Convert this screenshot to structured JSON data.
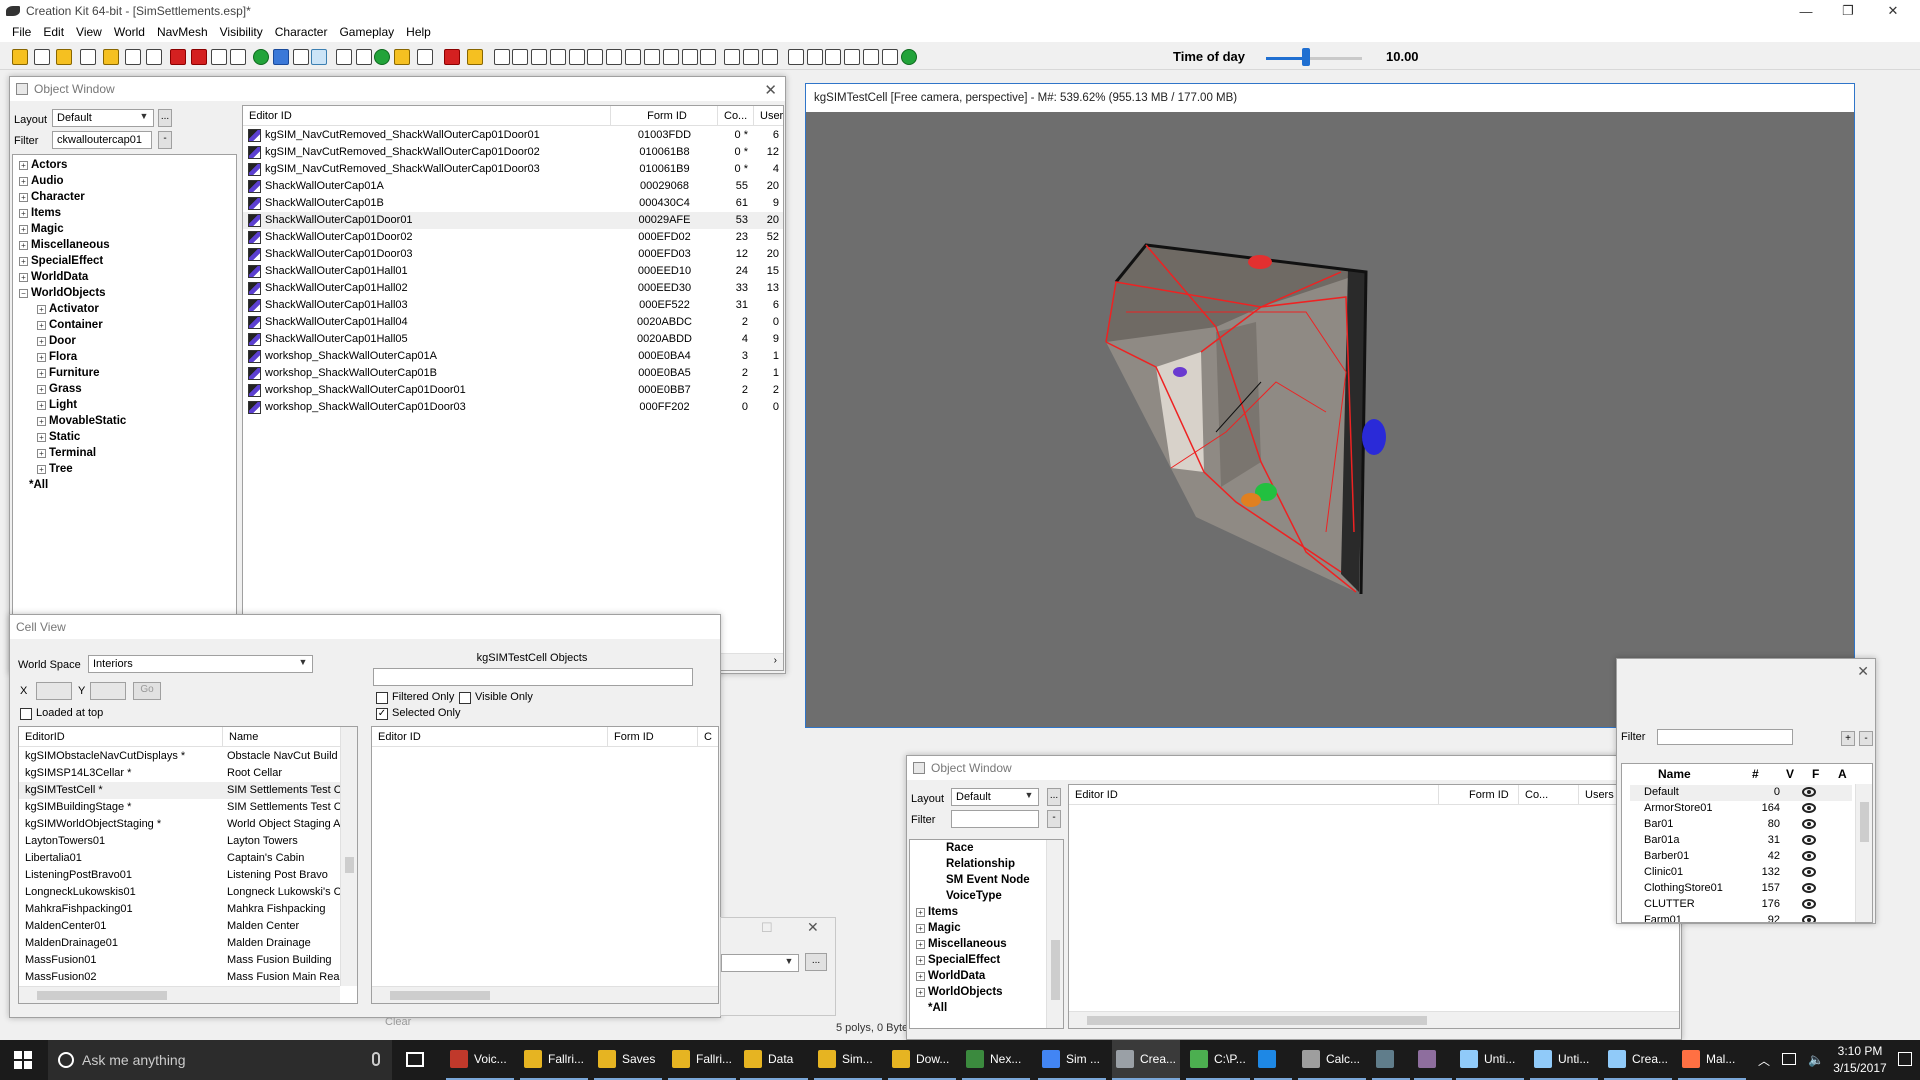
{
  "titlebar": {
    "title": "Creation Kit 64-bit - [SimSettlements.esp]*",
    "minimize": "—",
    "restore": "❐",
    "close": "✕"
  },
  "menubar": {
    "items": [
      "File",
      "Edit",
      "View",
      "World",
      "NavMesh",
      "Visibility",
      "Character",
      "Gameplay",
      "Help"
    ]
  },
  "toolbar": {
    "time_of_day_label": "Time of day",
    "time_of_day_value": "10.00",
    "time_of_day_slider_fraction": 0.42
  },
  "object_window": {
    "title": "Object Window",
    "layout_label": "Layout",
    "layout_value": "Default",
    "layout_more": "...",
    "filter_label": "Filter",
    "filter_value": "ckwalloutercap01",
    "filter_btn": "-",
    "tree": {
      "top": [
        "Actors",
        "Audio",
        "Character",
        "Items",
        "Magic",
        "Miscellaneous",
        "SpecialEffect",
        "WorldData",
        "WorldObjects"
      ],
      "children": [
        "Activator",
        "Container",
        "Door",
        "Flora",
        "Furniture",
        "Grass",
        "Light",
        "MovableStatic",
        "Static",
        "Terminal",
        "Tree"
      ],
      "all": "*All"
    },
    "columns": [
      "Editor ID",
      "Form ID",
      "Co...",
      "User"
    ],
    "rows": [
      {
        "id": "kgSIM_NavCutRemoved_ShackWallOuterCap01Door01",
        "form": "01003FDD",
        "count": "0 *",
        "users": "6"
      },
      {
        "id": "kgSIM_NavCutRemoved_ShackWallOuterCap01Door02",
        "form": "010061B8",
        "count": "0 *",
        "users": "12"
      },
      {
        "id": "kgSIM_NavCutRemoved_ShackWallOuterCap01Door03",
        "form": "010061B9",
        "count": "0 *",
        "users": "4"
      },
      {
        "id": "ShackWallOuterCap01A",
        "form": "00029068",
        "count": "55",
        "users": "20"
      },
      {
        "id": "ShackWallOuterCap01B",
        "form": "000430C4",
        "count": "61",
        "users": "9"
      },
      {
        "id": "ShackWallOuterCap01Door01",
        "form": "00029AFE",
        "count": "53",
        "users": "20"
      },
      {
        "id": "ShackWallOuterCap01Door02",
        "form": "000EFD02",
        "count": "23",
        "users": "52"
      },
      {
        "id": "ShackWallOuterCap01Door03",
        "form": "000EFD03",
        "count": "12",
        "users": "20"
      },
      {
        "id": "ShackWallOuterCap01Hall01",
        "form": "000EED10",
        "count": "24",
        "users": "15"
      },
      {
        "id": "ShackWallOuterCap01Hall02",
        "form": "000EED30",
        "count": "33",
        "users": "13"
      },
      {
        "id": "ShackWallOuterCap01Hall03",
        "form": "000EF522",
        "count": "31",
        "users": "6"
      },
      {
        "id": "ShackWallOuterCap01Hall04",
        "form": "0020ABDC",
        "count": "2",
        "users": "0"
      },
      {
        "id": "ShackWallOuterCap01Hall05",
        "form": "0020ABDD",
        "count": "4",
        "users": "9"
      },
      {
        "id": "workshop_ShackWallOuterCap01A",
        "form": "000E0BA4",
        "count": "3",
        "users": "1"
      },
      {
        "id": "workshop_ShackWallOuterCap01B",
        "form": "000E0BA5",
        "count": "2",
        "users": "1"
      },
      {
        "id": "workshop_ShackWallOuterCap01Door01",
        "form": "000E0BB7",
        "count": "2",
        "users": "2"
      },
      {
        "id": "workshop_ShackWallOuterCap01Door03",
        "form": "000FF202",
        "count": "0",
        "users": "0"
      }
    ]
  },
  "render_window": {
    "title": "kgSIMTestCell [Free camera, perspective] - M#: 539.62% (955.13 MB / 177.00 MB)"
  },
  "cell_view": {
    "title": "Cell View",
    "world_space_label": "World Space",
    "world_space_value": "Interiors",
    "x_label": "X",
    "y_label": "Y",
    "go_label": "Go",
    "loaded_at_top": "Loaded at top",
    "objects_title": "kgSIMTestCell Objects",
    "filtered_only": "Filtered Only",
    "visible_only": "Visible Only",
    "selected_only": "Selected Only",
    "left_columns": [
      "EditorID",
      "Name"
    ],
    "right_columns": [
      "Editor ID",
      "Form ID",
      "C"
    ],
    "cells": [
      {
        "editor": "kgSIMObstacleNavCutDisplays *",
        "name": "Obstacle NavCut Build C"
      },
      {
        "editor": "kgSIMSP14L3Cellar *",
        "name": "Root Cellar"
      },
      {
        "editor": "kgSIMTestCell *",
        "name": "SIM Settlements Test Ce"
      },
      {
        "editor": "kgSIMBuildingStage *",
        "name": "SIM Settlements Test Ce"
      },
      {
        "editor": "kgSIMWorldObjectStaging *",
        "name": "World Object Staging Ar"
      },
      {
        "editor": "LaytonTowers01",
        "name": "Layton Towers"
      },
      {
        "editor": "Libertalia01",
        "name": "Captain's Cabin"
      },
      {
        "editor": "ListeningPostBravo01",
        "name": "Listening Post Bravo"
      },
      {
        "editor": "LongneckLukowskis01",
        "name": "Longneck Lukowski's Ca"
      },
      {
        "editor": "MahkraFishpacking01",
        "name": "Mahkra Fishpacking"
      },
      {
        "editor": "MaldenCenter01",
        "name": "Malden Center"
      },
      {
        "editor": "MaldenDrainage01",
        "name": "Malden Drainage"
      },
      {
        "editor": "MassFusion01",
        "name": "Mass Fusion Building"
      },
      {
        "editor": "MassFusion02",
        "name": "Mass Fusion Main React"
      }
    ],
    "clear_btn": "Clear"
  },
  "status_fragment": "5 polys, 0 Byte",
  "small_dialog": {
    "more_btn": "..."
  },
  "object_window_2": {
    "title": "Object Window",
    "layout_label": "Layout",
    "layout_value": "Default",
    "filter_label": "Filter",
    "tree_items": [
      {
        "label": "Race",
        "child": true
      },
      {
        "label": "Relationship",
        "child": true
      },
      {
        "label": "SM Event Node",
        "child": true
      },
      {
        "label": "VoiceType",
        "child": true
      },
      {
        "label": "Items",
        "child": false
      },
      {
        "label": "Magic",
        "child": false
      },
      {
        "label": "Miscellaneous",
        "child": false
      },
      {
        "label": "SpecialEffect",
        "child": false
      },
      {
        "label": "WorldData",
        "child": false
      },
      {
        "label": "WorldObjects",
        "child": false
      },
      {
        "label": "*All",
        "child": false
      }
    ],
    "columns": [
      "Editor ID",
      "Form ID",
      "Co...",
      "Users"
    ]
  },
  "layers_panel": {
    "filter_label": "Filter",
    "add_btn": "+",
    "remove_btn": "-",
    "columns": [
      "Name",
      "#",
      "V",
      "F",
      "A"
    ],
    "rows": [
      {
        "name": "Default",
        "count": "0"
      },
      {
        "name": "ArmorStore01",
        "count": "164"
      },
      {
        "name": "Bar01",
        "count": "80"
      },
      {
        "name": "Bar01a",
        "count": "31"
      },
      {
        "name": "Barber01",
        "count": "42"
      },
      {
        "name": "Clinic01",
        "count": "132"
      },
      {
        "name": "ClothingStore01",
        "count": "157"
      },
      {
        "name": "CLUTTER",
        "count": "176"
      },
      {
        "name": "Farm01",
        "count": "92"
      }
    ]
  },
  "taskbar": {
    "search_placeholder": "Ask me anything",
    "apps": [
      {
        "label": "Voic...",
        "color": "#c0392b"
      },
      {
        "label": "Fallri...",
        "color": "#e6b422"
      },
      {
        "label": "Saves",
        "color": "#e6b422"
      },
      {
        "label": "Fallri...",
        "color": "#e6b422"
      },
      {
        "label": "Data",
        "color": "#e6b422"
      },
      {
        "label": "Sim...",
        "color": "#e6b422"
      },
      {
        "label": "Dow...",
        "color": "#e6b422"
      },
      {
        "label": "Nex...",
        "color": "#3b8a3e"
      },
      {
        "label": "Sim ...",
        "color": "#4285f4"
      },
      {
        "label": "Crea...",
        "color": "#9aa0a6"
      },
      {
        "label": "C:\\P...",
        "color": "#4caf50"
      },
      {
        "label": "",
        "color": "#1e88e5"
      },
      {
        "label": "Calc...",
        "color": "#9e9e9e"
      },
      {
        "label": "",
        "color": "#607d8b"
      },
      {
        "label": "",
        "color": "#8e6e9e"
      },
      {
        "label": "Unti...",
        "color": "#90caf9"
      },
      {
        "label": "Unti...",
        "color": "#90caf9"
      },
      {
        "label": "Crea...",
        "color": "#90caf9"
      },
      {
        "label": "Mal...",
        "color": "#ff7043"
      }
    ],
    "time": "3:10 PM",
    "date": "3/15/2017"
  }
}
